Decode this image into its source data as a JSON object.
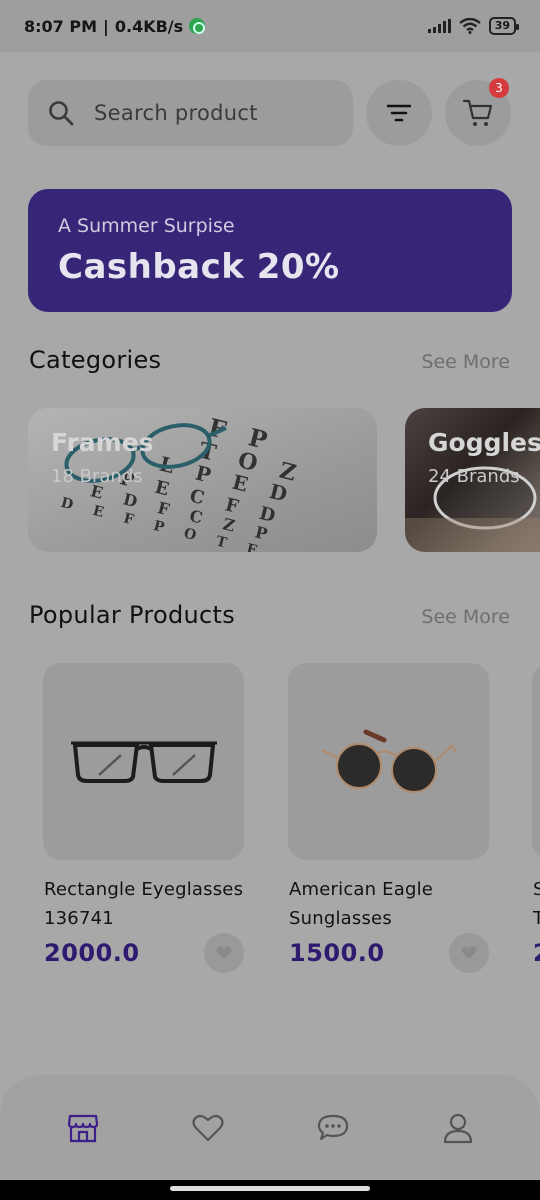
{
  "status_bar": {
    "time": "8:07 PM",
    "speed": "0.4KB/s",
    "battery": "39"
  },
  "search": {
    "placeholder": "Search product",
    "icon": "search-icon"
  },
  "header": {
    "filter_icon": "filter-icon",
    "cart_icon": "cart-icon",
    "cart_count": "3"
  },
  "promo": {
    "subtitle": "A Summer Surpise",
    "title": "Cashback 20%",
    "color": "#372677"
  },
  "categories": {
    "title": "Categories",
    "see_more": "See More",
    "items": [
      {
        "name": "Frames",
        "brands": "18 Brands"
      },
      {
        "name": "Goggles",
        "brands": "24 Brands"
      }
    ]
  },
  "popular": {
    "title": "Popular Products",
    "see_more": "See More",
    "products": [
      {
        "name_line1": "Rectangle Eyeglasses",
        "name_line2": "136741",
        "price": "2000.0"
      },
      {
        "name_line1": "American Eagle",
        "name_line2": "Sunglasses",
        "price": "1500.0"
      },
      {
        "name_line1": "S",
        "name_line2": "T",
        "price": "2"
      }
    ]
  },
  "bottom_nav": {
    "items": [
      "store-icon",
      "heart-icon",
      "chat-icon",
      "profile-icon"
    ],
    "active": "store-icon",
    "accent": "#3d1f8a"
  }
}
